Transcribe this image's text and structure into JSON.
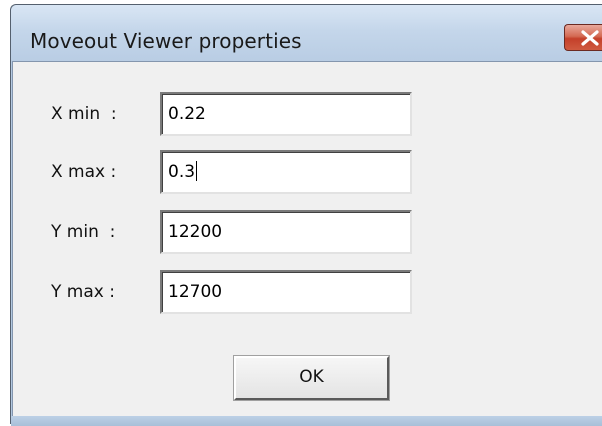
{
  "window": {
    "title": "Moveout Viewer properties",
    "close_icon": "close-icon"
  },
  "fields": [
    {
      "label": "X min  :",
      "value": "0.22"
    },
    {
      "label": "X max :",
      "value": "0.3"
    },
    {
      "label": "Y min  :",
      "value": "12200"
    },
    {
      "label": "Y max :",
      "value": "12700"
    }
  ],
  "buttons": {
    "ok_label": "OK"
  },
  "colors": {
    "close_button": "#c4402a",
    "title_bar": "#c4d6ea",
    "client_bg": "#f0f0f0"
  }
}
